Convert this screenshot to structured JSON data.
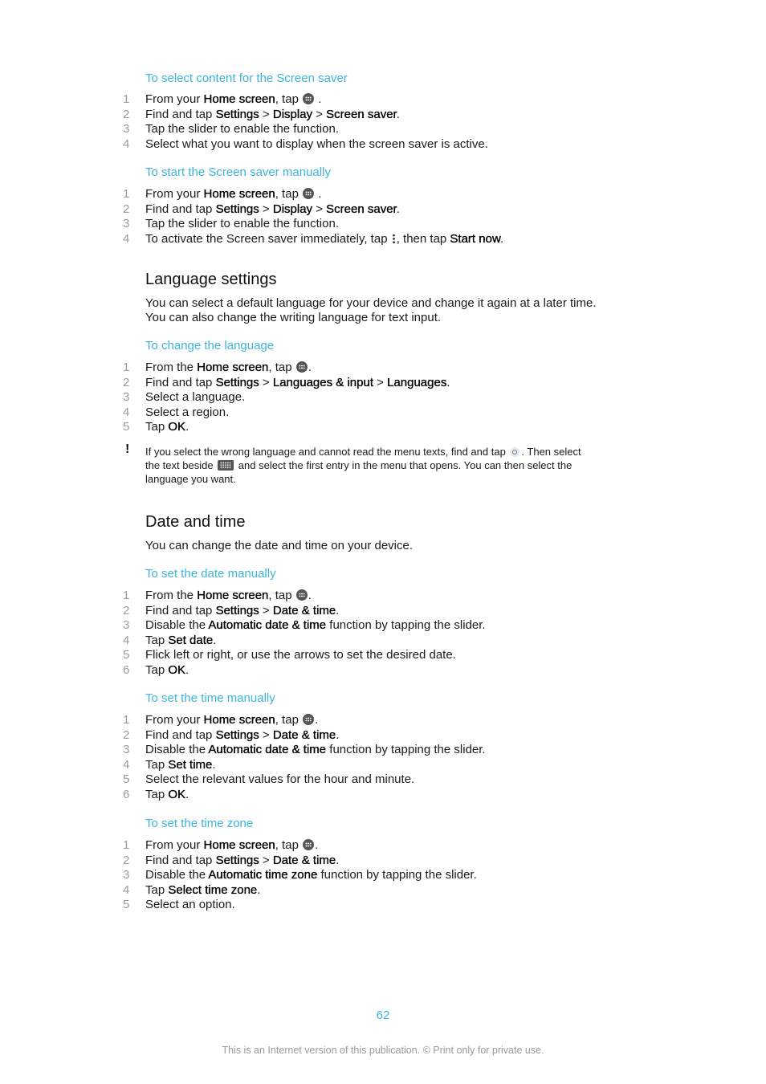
{
  "sections": {
    "screen_saver_select": {
      "title": "To select content for the Screen saver",
      "steps": [
        {
          "n": "1",
          "a": "From your ",
          "b": "Home screen",
          "c": ", tap ",
          "d": " ."
        },
        {
          "n": "2",
          "a": "Find and tap ",
          "b1": "Settings",
          "s1": " > ",
          "b2": "Display",
          "s2": " > ",
          "b3": "Screen saver",
          "end": "."
        },
        {
          "n": "3",
          "a": "Tap the slider to enable the function."
        },
        {
          "n": "4",
          "a": "Select what you want to display when the screen saver is active."
        }
      ]
    },
    "screen_saver_start": {
      "title": "To start the Screen saver manually",
      "steps": [
        {
          "n": "1",
          "a": "From your ",
          "b": "Home screen",
          "c": ", tap ",
          "d": " ."
        },
        {
          "n": "2",
          "a": "Find and tap ",
          "b1": "Settings",
          "s1": " > ",
          "b2": "Display",
          "s2": " > ",
          "b3": "Screen saver",
          "end": "."
        },
        {
          "n": "3",
          "a": "Tap the slider to enable the function."
        },
        {
          "n": "4",
          "a": "To activate the Screen saver immediately, tap ",
          "c": ", then tap ",
          "b": "Start now",
          "end": "."
        }
      ]
    },
    "language": {
      "heading": "Language settings",
      "intro": [
        "You can select a default language for your device and change it again at a later time.",
        "You can also change the writing language for text input."
      ],
      "title": "To change the language",
      "steps": [
        {
          "n": "1",
          "a": "From the ",
          "b": "Home screen",
          "c": ", tap ",
          "d": "."
        },
        {
          "n": "2",
          "a": "Find and tap ",
          "b1": "Settings",
          "s1": " > ",
          "b2": "Languages & input",
          "s2": " > ",
          "b3": "Languages",
          "end": "."
        },
        {
          "n": "3",
          "a": "Select a language."
        },
        {
          "n": "4",
          "a": "Select a region."
        },
        {
          "n": "5",
          "a": "Tap ",
          "b": "OK",
          "end": "."
        }
      ],
      "note": {
        "l1a": "If you select the wrong language and cannot read the menu texts, find and tap ",
        "l1b": ". Then select",
        "l2a": "the text beside ",
        "l2b": " and select the first entry in the menu that opens. You can then select the",
        "l3": "language you want."
      }
    },
    "datetime": {
      "heading": "Date and time",
      "intro": "You can change the date and time on your device.",
      "date": {
        "title": "To set the date manually",
        "steps": [
          {
            "n": "1",
            "a": "From the ",
            "b": "Home screen",
            "c": ", tap ",
            "d": "."
          },
          {
            "n": "2",
            "a": "Find and tap ",
            "b1": "Settings",
            "s1": " > ",
            "b2": "Date & time",
            "end": "."
          },
          {
            "n": "3",
            "a": "Disable the ",
            "b": "Automatic date & time",
            "c": " function by tapping the slider."
          },
          {
            "n": "4",
            "a": "Tap ",
            "b": "Set date",
            "end": "."
          },
          {
            "n": "5",
            "a": "Flick left or right, or use the arrows to set the desired date."
          },
          {
            "n": "6",
            "a": "Tap ",
            "b": "OK",
            "end": "."
          }
        ]
      },
      "time": {
        "title": "To set the time manually",
        "steps": [
          {
            "n": "1",
            "a": "From your ",
            "b": "Home screen",
            "c": ", tap ",
            "d": "."
          },
          {
            "n": "2",
            "a": "Find and tap ",
            "b1": "Settings",
            "s1": " > ",
            "b2": "Date & time",
            "end": "."
          },
          {
            "n": "3",
            "a": "Disable the ",
            "b": "Automatic date & time",
            "c": " function by tapping the slider."
          },
          {
            "n": "4",
            "a": "Tap ",
            "b": "Set time",
            "end": "."
          },
          {
            "n": "5",
            "a": "Select the relevant values for the hour and minute."
          },
          {
            "n": "6",
            "a": "Tap ",
            "b": "OK",
            "end": "."
          }
        ]
      },
      "zone": {
        "title": "To set the time zone",
        "steps": [
          {
            "n": "1",
            "a": "From your ",
            "b": "Home screen",
            "c": ", tap ",
            "d": "."
          },
          {
            "n": "2",
            "a": "Find and tap ",
            "b1": "Settings",
            "s1": " > ",
            "b2": "Date & time",
            "end": "."
          },
          {
            "n": "3",
            "a": "Disable the ",
            "b": "Automatic time zone",
            "c": " function by tapping the slider."
          },
          {
            "n": "4",
            "a": "Tap ",
            "b": "Select time zone",
            "end": "."
          },
          {
            "n": "5",
            "a": "Select an option."
          }
        ]
      }
    }
  },
  "icons": {
    "apps": "apps-grid-icon",
    "menu": "overflow-menu-icon",
    "settings": "settings-gear-icon",
    "keyboard": "keyboard-icon",
    "warning": "important-note-icon"
  },
  "footer": {
    "page_number": "62",
    "notice": "This is an Internet version of this publication. © Print only for private use."
  },
  "colors": {
    "accent": "#3cb4dc",
    "step_number": "#9a9a9a",
    "text": "#1a1a1a"
  }
}
